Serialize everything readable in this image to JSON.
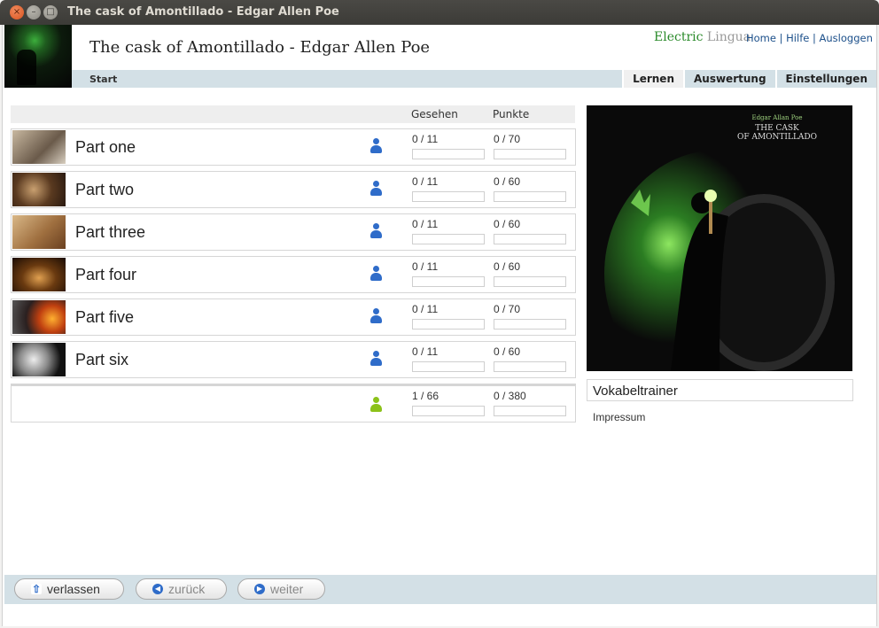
{
  "window": {
    "title": "The cask of Amontillado - Edgar Allen Poe"
  },
  "header": {
    "title": "The cask of Amontillado - Edgar Allen Poe",
    "brand_part1": "Electric",
    "brand_part2": "Lingua",
    "links": {
      "home": "Home",
      "help": "Hilfe",
      "logout": "Ausloggen",
      "sep": "|"
    },
    "breadcrumb": "Start",
    "tabs": [
      "Lernen",
      "Auswertung",
      "Einstellungen"
    ],
    "active_tab": "Lernen"
  },
  "table": {
    "headers": {
      "seen": "Gesehen",
      "points": "Punkte"
    },
    "rows": [
      {
        "label": "Part one",
        "seen": "0 / 11",
        "points": "0 / 70",
        "thumb": "living-room"
      },
      {
        "label": "Part two",
        "seen": "0 / 11",
        "points": "0 / 60",
        "thumb": "jester"
      },
      {
        "label": "Part three",
        "seen": "0 / 11",
        "points": "0 / 60",
        "thumb": "sack"
      },
      {
        "label": "Part four",
        "seen": "0 / 11",
        "points": "0 / 60",
        "thumb": "vault"
      },
      {
        "label": "Part five",
        "seen": "0 / 11",
        "points": "0 / 70",
        "thumb": "fireplace"
      },
      {
        "label": "Part six",
        "seen": "0 / 11",
        "points": "0 / 60",
        "thumb": "skull"
      }
    ],
    "total": {
      "seen": "1 / 66",
      "points": "0 / 380"
    }
  },
  "sidebar": {
    "vokabel": "Vokabeltrainer",
    "impressum": "Impressum"
  },
  "cover": {
    "author": "Edgar Allan Poe",
    "title_line1": "THE CASK",
    "title_line2": "OF AMONTILLADO"
  },
  "footer": {
    "leave": "verlassen",
    "back": "zurück",
    "next": "weiter"
  },
  "colors": {
    "nav_bg": "#d3e0e6",
    "link": "#1b4f8a",
    "brand_green": "#2a8a2a",
    "person_blue": "#2f6cc9",
    "person_green": "#8cc21a"
  },
  "icons": {
    "user": "person-icon",
    "leave": "arrow-up-icon",
    "back": "arrow-left-icon",
    "next": "arrow-right-icon"
  }
}
